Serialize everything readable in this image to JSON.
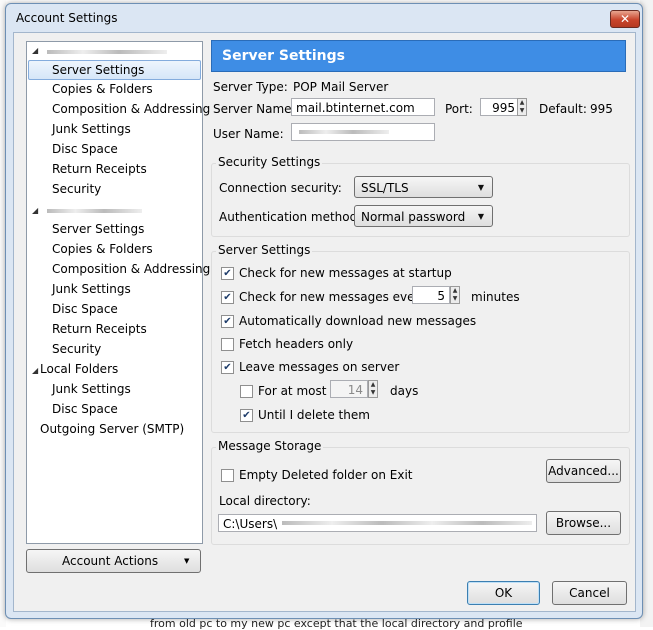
{
  "window": {
    "title": "Account Settings",
    "close_symbol": "✕"
  },
  "tree": {
    "items": [
      {
        "label": "",
        "level": 0
      },
      {
        "label": "Server Settings",
        "level": 1,
        "selected": true
      },
      {
        "label": "Copies & Folders",
        "level": 1
      },
      {
        "label": "Composition & Addressing",
        "level": 1
      },
      {
        "label": "Junk Settings",
        "level": 1
      },
      {
        "label": "Disc Space",
        "level": 1
      },
      {
        "label": "Return Receipts",
        "level": 1
      },
      {
        "label": "Security",
        "level": 1
      },
      {
        "label": "",
        "level": 0
      },
      {
        "label": "Server Settings",
        "level": 1
      },
      {
        "label": "Copies & Folders",
        "level": 1
      },
      {
        "label": "Composition & Addressing",
        "level": 1
      },
      {
        "label": "Junk Settings",
        "level": 1
      },
      {
        "label": "Disc Space",
        "level": 1
      },
      {
        "label": "Return Receipts",
        "level": 1
      },
      {
        "label": "Security",
        "level": 1
      },
      {
        "label": "Local Folders",
        "level": 0
      },
      {
        "label": "Junk Settings",
        "level": 1
      },
      {
        "label": "Disc Space",
        "level": 1
      },
      {
        "label": "Outgoing Server (SMTP)",
        "level": 0
      }
    ],
    "account_actions_label": "Account Actions",
    "account_actions_caret": "▼"
  },
  "panel": {
    "header": "Server Settings",
    "server_type_label": "Server Type:",
    "server_type_value": "POP Mail Server",
    "server_name_label": "Server Name:",
    "server_name_value": "mail.btinternet.com",
    "port_label": "Port:",
    "port_value": "995",
    "default_label": "Default:",
    "default_value": "995",
    "user_name_label": "User Name:",
    "user_name_value": ""
  },
  "security": {
    "title": "Security Settings",
    "connection_label": "Connection security:",
    "connection_value": "SSL/TLS",
    "auth_label": "Authentication method:",
    "auth_value": "Normal password"
  },
  "server_settings": {
    "title": "Server Settings",
    "check_startup": "Check for new messages at startup",
    "check_every": "Check for new messages every",
    "check_every_value": "5",
    "minutes": "minutes",
    "auto_download": "Automatically download new messages",
    "fetch_headers": "Fetch headers only",
    "leave_on_server": "Leave messages on server",
    "for_at_most": "For at most",
    "for_at_most_value": "14",
    "days": "days",
    "until_delete": "Until I delete them",
    "check_mark": "✔"
  },
  "storage": {
    "title": "Message Storage",
    "empty_deleted": "Empty Deleted folder on Exit",
    "advanced_button": "Advanced...",
    "local_dir_label": "Local directory:",
    "local_dir_value": "C:\\Users\\",
    "browse_button": "Browse..."
  },
  "footer": {
    "ok_button": "OK",
    "cancel_button": "Cancel"
  },
  "background": {
    "bottom_text": "from old pc to my new pc except that the local directory and profile"
  }
}
